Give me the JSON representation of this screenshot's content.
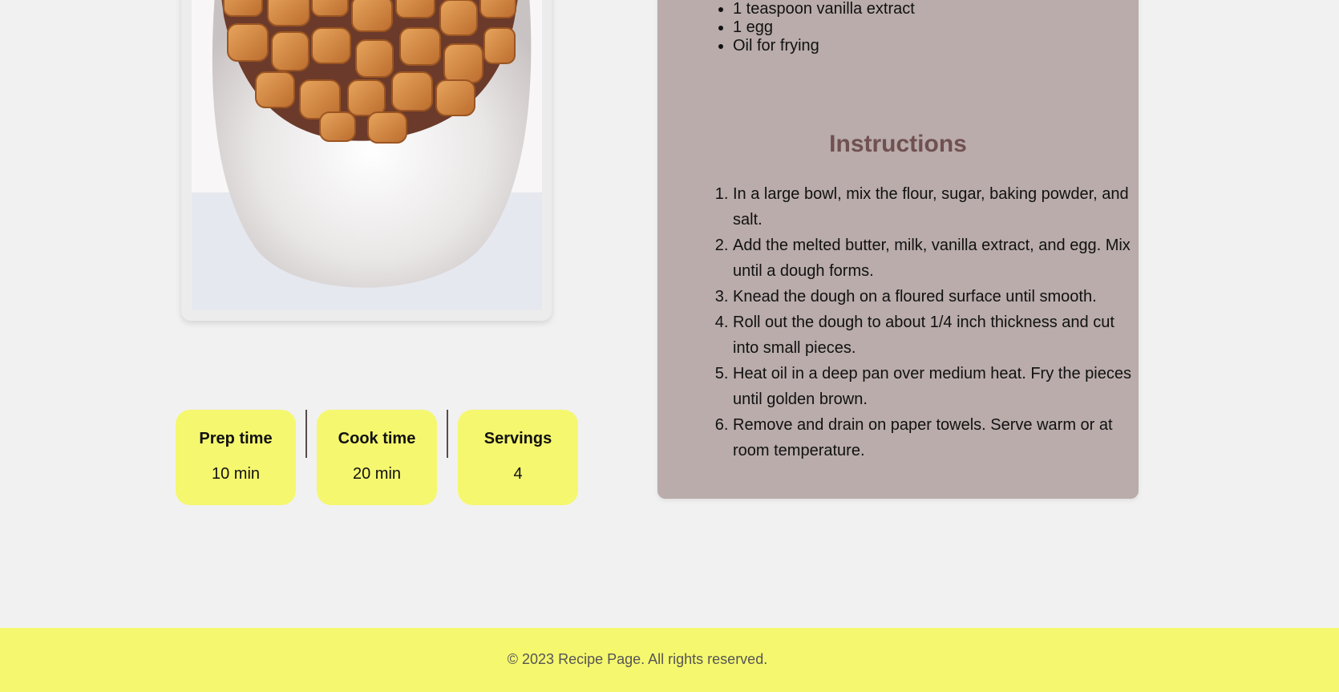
{
  "ingredients": [
    "1 teaspoon vanilla extract",
    "1 egg",
    "Oil for frying"
  ],
  "instructions_heading": "Instructions",
  "instructions": [
    "In a large bowl, mix the flour, sugar, baking powder, and salt.",
    "Add the melted butter, milk, vanilla extract, and egg. Mix until a dough forms.",
    "Knead the dough on a floured surface until smooth.",
    "Roll out the dough to about 1/4 inch thickness and cut into small pieces.",
    "Heat oil in a deep pan over medium heat. Fry the pieces until golden brown.",
    "Remove and drain on paper towels. Serve warm or at room temperature."
  ],
  "info": [
    {
      "label": "Prep time",
      "value": "10 min"
    },
    {
      "label": "Cook time",
      "value": "20 min"
    },
    {
      "label": "Servings",
      "value": "4"
    }
  ],
  "footer": {
    "text": "© 2023 Recipe Page. All rights reserved."
  },
  "colors": {
    "background": "#f1f1f1",
    "panel": "#b9acab",
    "accent_yellow": "#f5f76f",
    "heading": "#705050"
  }
}
